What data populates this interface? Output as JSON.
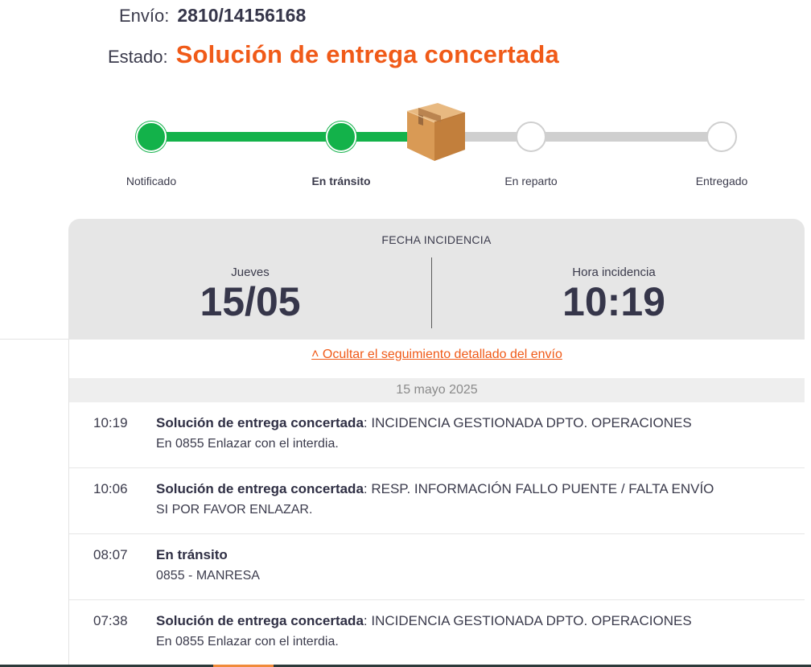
{
  "header": {
    "envio_label": "Envío:",
    "envio_value": "2810/14156168",
    "estado_label": "Estado:",
    "estado_value": "Solución de entrega concertada",
    "status_color": "#f05a18"
  },
  "tracker": {
    "steps": [
      {
        "label": "Notificado",
        "state": "done"
      },
      {
        "label": "En tránsito",
        "state": "done",
        "active": true
      },
      {
        "label": "En reparto",
        "state": "pending"
      },
      {
        "label": "Entregado",
        "state": "pending"
      }
    ],
    "current_icon": "package-box-icon",
    "done_color": "#13b24a",
    "pending_color": "#cfcfcf"
  },
  "incident": {
    "title": "FECHA INCIDENCIA",
    "day_label": "Jueves",
    "date": "15/05",
    "time_label": "Hora incidencia",
    "time": "10:19"
  },
  "detail": {
    "toggle_label": "˄ Ocultar el seguimiento detallado del envío",
    "date_header": "15 mayo 2025",
    "events": [
      {
        "time": "10:19",
        "status": "Solución de entrega concertada",
        "message": ": INCIDENCIA GESTIONADA DPTO. OPERACIONES",
        "detail": "En 0855 Enlazar con el interdia."
      },
      {
        "time": "10:06",
        "status": "Solución de entrega concertada",
        "message": ": RESP. INFORMACIÓN FALLO PUENTE / FALTA ENVÍO",
        "detail": "SI POR FAVOR ENLAZAR."
      },
      {
        "time": "08:07",
        "status": "En tránsito",
        "message": "",
        "detail": "0855 - MANRESA"
      },
      {
        "time": "07:38",
        "status": "Solución de entrega concertada",
        "message": ": INCIDENCIA GESTIONADA DPTO. OPERACIONES",
        "detail": "En 0855 Enlazar con el interdia."
      }
    ]
  }
}
